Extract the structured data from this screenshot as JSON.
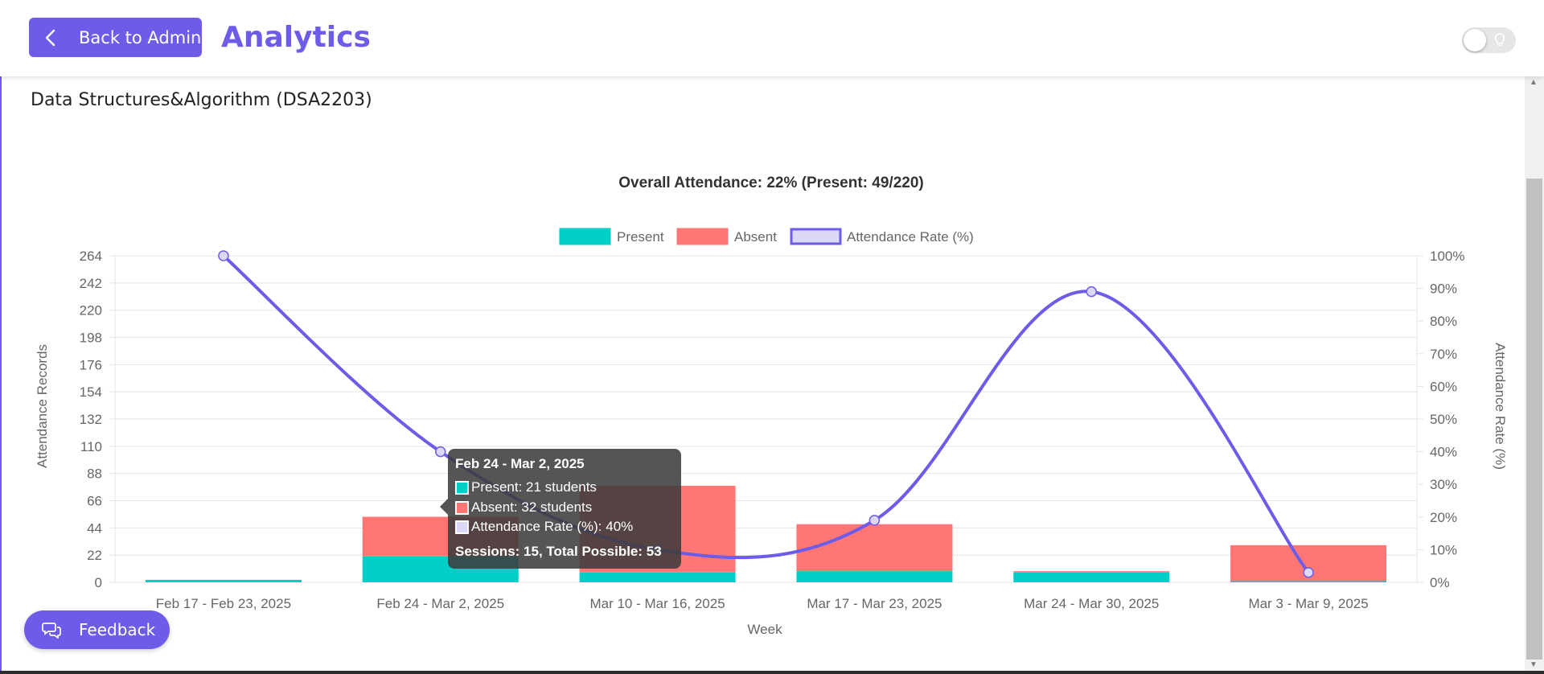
{
  "header": {
    "back_label": "Back to Admin",
    "title": "Analytics"
  },
  "course": {
    "title": "Data Structures&Algorithm (DSA2203)"
  },
  "feedback": {
    "label": "Feedback"
  },
  "tooltip": {
    "title": "Feb 24 - Mar 2, 2025",
    "rows": [
      {
        "text": "Present: 21 students",
        "color": "#00cfc8"
      },
      {
        "text": "Absent: 32 students",
        "color": "#ff7675"
      },
      {
        "text": "Attendance Rate (%): 40%",
        "color": "#dcd8f7"
      }
    ],
    "footer": "Sessions: 15, Total Possible: 53"
  },
  "colors": {
    "accent": "#6c5ce7",
    "present": "#00cfc8",
    "absent": "#ff7675",
    "rate_fill": "#dcd8f7"
  },
  "chart_data": {
    "type": "bar",
    "title": "Overall Attendance: 22% (Present: 49/220)",
    "xlabel": "Week",
    "ylabel": "Attendance Records",
    "y2label": "Attendance Rate (%)",
    "ylim": [
      0,
      264
    ],
    "y2lim": [
      0,
      100
    ],
    "yticks": [
      "264",
      "242",
      "220",
      "198",
      "176",
      "154",
      "132",
      "110",
      "88",
      "66",
      "44",
      "22",
      "0"
    ],
    "y2ticks": [
      "100%",
      "90%",
      "80%",
      "70%",
      "60%",
      "50%",
      "40%",
      "30%",
      "20%",
      "10%",
      "0%"
    ],
    "categories": [
      "Feb 17 - Feb 23, 2025",
      "Feb 24 - Mar 2, 2025",
      "Mar 10 - Mar 16, 2025",
      "Mar 17 - Mar 23, 2025",
      "Mar 24 - Mar 30, 2025",
      "Mar 3 - Mar 9, 2025"
    ],
    "legend_position": "top",
    "series": [
      {
        "name": "Present",
        "kind": "bar",
        "stack": true,
        "values": [
          2,
          21,
          8,
          9,
          8,
          1
        ]
      },
      {
        "name": "Absent",
        "kind": "bar",
        "stack": true,
        "values": [
          0,
          32,
          70,
          38,
          1,
          29
        ]
      },
      {
        "name": "Attendance Rate (%)",
        "kind": "line",
        "axis": "right",
        "values": [
          100,
          40,
          10,
          19,
          89,
          3
        ]
      }
    ]
  }
}
